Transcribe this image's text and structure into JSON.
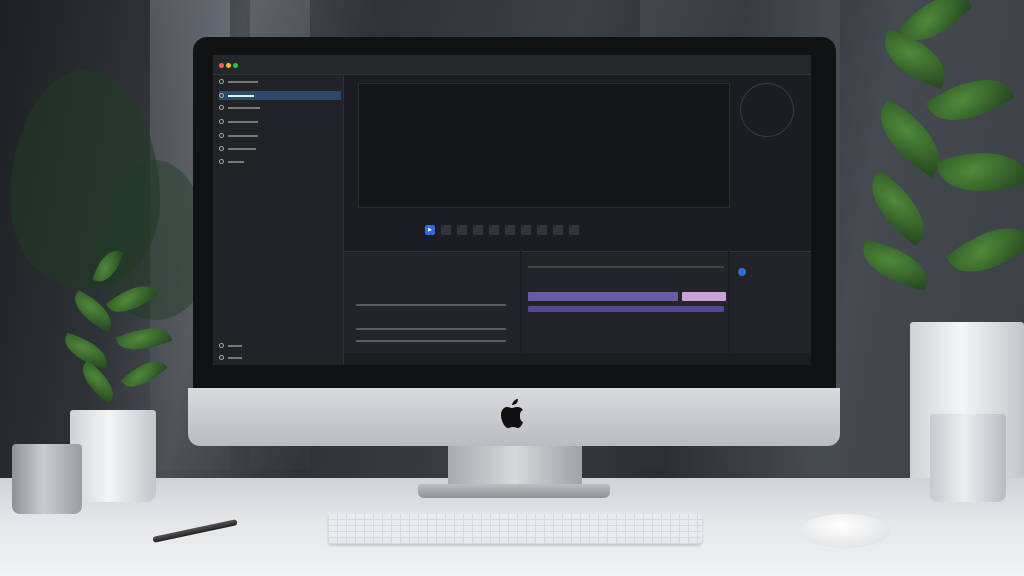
{
  "scene": {
    "device": "iMac",
    "brand_icon": "apple-logo",
    "screen_app": "video-editor",
    "colors": {
      "accent": "#2d6fd6",
      "clip_purple": "#6b5aa8",
      "clip_pink": "#c9a0d8",
      "sidebar_active": "#2b4a6b"
    }
  },
  "icons": [
    "apple-logo",
    "play-icon",
    "scope-icon",
    "window-controls"
  ]
}
